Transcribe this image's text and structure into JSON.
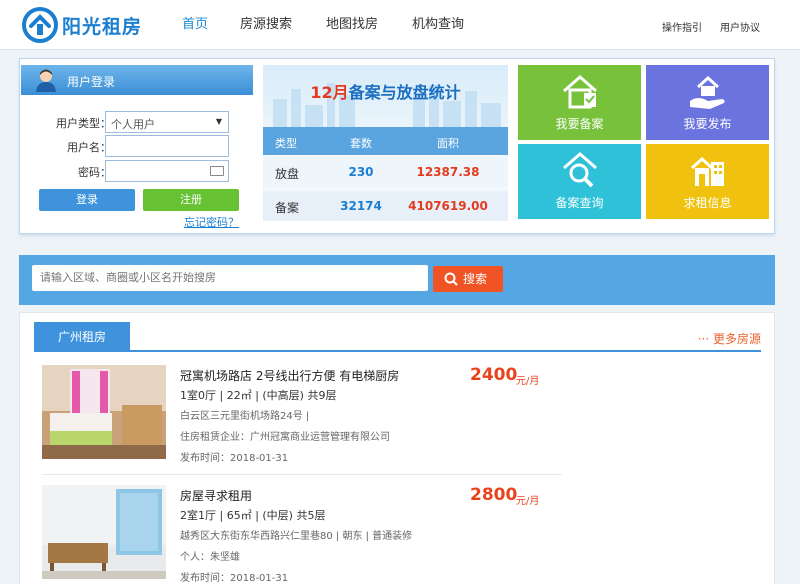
{
  "brand": {
    "name": "阳光租房"
  },
  "nav": {
    "items": [
      "首页",
      "房源搜索",
      "地图找房",
      "机构查询"
    ]
  },
  "top_links": [
    "操作指引",
    "用户协议"
  ],
  "login": {
    "title": "用户登录",
    "type_label": "用户类型：",
    "type_value": "个人用户",
    "username_label": "用户名：",
    "password_label": "密码：",
    "login_button": "登录",
    "register_button": "注册",
    "forgot": "忘记密码？"
  },
  "stats": {
    "title_month": "12月",
    "title_rest": "备案与放盘统计",
    "headers": [
      "类型",
      "套数",
      "面积"
    ],
    "rows": [
      {
        "type": "放盘",
        "count": "230",
        "area": "12387.38"
      },
      {
        "type": "备案",
        "count": "32174",
        "area": "4107619.00"
      }
    ]
  },
  "tiles": [
    {
      "label": "我要备案",
      "icon": "house-register-icon",
      "color": "#77c23a"
    },
    {
      "label": "我要发布",
      "icon": "house-publish-icon",
      "color": "#6b73df"
    },
    {
      "label": "备案查询",
      "icon": "house-search-icon",
      "color": "#2ec1d8"
    },
    {
      "label": "求租信息",
      "icon": "buildings-icon",
      "color": "#f0c20f"
    }
  ],
  "search": {
    "placeholder": "请输入区域、商圈或小区名开始搜房",
    "button": "搜索"
  },
  "section": {
    "tab": "广州租房",
    "more": "更多房源"
  },
  "listings": [
    {
      "title": "冠寓机场路店 2号线出行方便 有电梯厨房",
      "spec": "1室0厅 | 22㎡ | (中高层) 共9层",
      "address": "白云区三元里街机场路24号 |",
      "org": "住房租赁企业：广州冠寓商业运营管理有限公司",
      "time": "发布时间：2018-01-31",
      "price": "2400",
      "unit": "元/月"
    },
    {
      "title": "房屋寻求租用",
      "spec": "2室1厅 | 65㎡ | (中层) 共5层",
      "address": "越秀区大东街东华西路兴仁里巷80 | 朝东 | 普通装修",
      "org": "个人：朱坚雄",
      "time": "发布时间：2018-01-31",
      "price": "2800",
      "unit": "元/月"
    }
  ]
}
